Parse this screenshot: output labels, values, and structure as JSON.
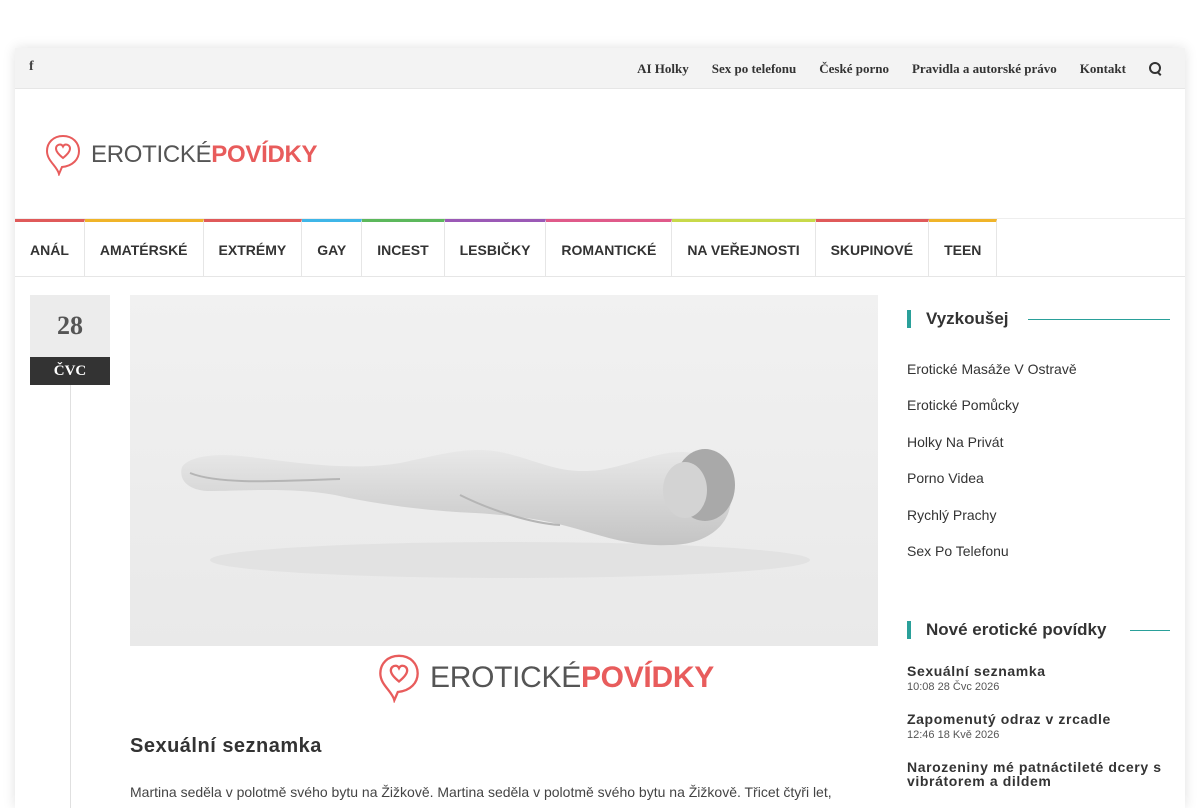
{
  "topbar": {
    "facebook_icon": "f",
    "links": [
      "AI Holky",
      "Sex po telefonu",
      "České porno",
      "Pravidla a autorské právo",
      "Kontakt"
    ],
    "search_icon": "search-icon"
  },
  "logo": {
    "part1": "EROTICKÉ",
    "part2": "POVÍDKY"
  },
  "nav": {
    "items": [
      "ANÁL",
      "AMATÉRSKÉ",
      "EXTRÉMY",
      "GAY",
      "INCEST",
      "LESBIČKY",
      "ROMANTICKÉ",
      "NA VEŘEJNOSTI",
      "SKUPINOVÉ",
      "TEEN"
    ],
    "colors": [
      "#e05a5a",
      "#f0b429",
      "#e05a5a",
      "#3fb6e8",
      "#5cb85c",
      "#9b59b6",
      "#e05a8a",
      "#c8d94a",
      "#e05a5a",
      "#f0b429"
    ]
  },
  "post": {
    "day": "28",
    "month": "ČVC",
    "title": "Sexuální seznamka",
    "excerpt": "Martina seděla v polotmě svého bytu na Žižkově. Martina seděla v polotmě svého bytu na Žižkově. Třicet čtyři let,"
  },
  "sidebar": {
    "try_title": "Vyzkoušej",
    "try_links": [
      "Erotické Masáže V Ostravě",
      "Erotické Pomůcky",
      "Holky Na Privát",
      "Porno Videa",
      "Rychlý Prachy",
      "Sex Po Telefonu"
    ],
    "new_title": "Nové erotické povídky",
    "new_posts": [
      {
        "title": "Sexuální seznamka",
        "date": "10:08 28 Čvc 2026"
      },
      {
        "title": "Zapomenutý odraz v zrcadle",
        "date": "12:46 18 Kvě 2026"
      },
      {
        "title": "Narozeniny mé patnáctileté dcery s vibrátorem a dildem",
        "date": ""
      }
    ]
  },
  "colors": {
    "accent": "#2aa09a",
    "brand": "#e85c5c"
  }
}
